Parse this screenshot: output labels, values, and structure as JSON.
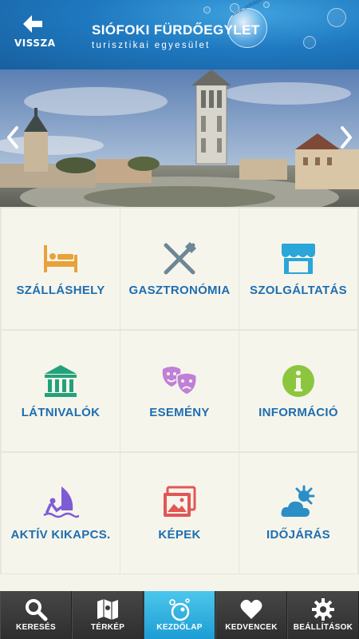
{
  "header": {
    "back_label": "VISSZA",
    "brand_title": "SIÓFOKI FÜRDŐEGYLET",
    "brand_subtitle": "turisztikai egyesület",
    "brand_url": "www.siofokportal.com"
  },
  "banner": {
    "prev_icon": "chevron-left-icon",
    "next_icon": "chevron-right-icon"
  },
  "tiles": [
    {
      "label": "SZÁLLÁSHELY",
      "icon": "bed-icon",
      "color": "#e8a23a"
    },
    {
      "label": "GASZTRONÓMIA",
      "icon": "fork-knife-icon",
      "color": "#6e8796"
    },
    {
      "label": "SZOLGÁLTATÁS",
      "icon": "shop-icon",
      "color": "#2aa6d8"
    },
    {
      "label": "LÁTNIVALÓK",
      "icon": "museum-icon",
      "color": "#22a27b"
    },
    {
      "label": "ESEMÉNY",
      "icon": "theater-masks-icon",
      "color": "#c07fd8"
    },
    {
      "label": "INFORMÁCIÓ",
      "icon": "info-icon",
      "color": "#8cc63f"
    },
    {
      "label": "AKTÍV KIKAPCS.",
      "icon": "windsurf-icon",
      "color": "#7d5cd6"
    },
    {
      "label": "KÉPEK",
      "icon": "pictures-icon",
      "color": "#e25655"
    },
    {
      "label": "IDŐJÁRÁS",
      "icon": "sun-cloud-icon",
      "color": "#2b8fc6"
    }
  ],
  "nav": [
    {
      "label": "KERESÉS",
      "icon": "search-icon"
    },
    {
      "label": "TÉRKÉP",
      "icon": "map-icon"
    },
    {
      "label": "KEZDŐLAP",
      "icon": "home-bubble-icon",
      "active": true
    },
    {
      "label": "KEDVENCEK",
      "icon": "heart-icon"
    },
    {
      "label": "BEÁLLÍTÁSOK",
      "icon": "gear-icon"
    }
  ],
  "colors": {
    "header_blue": "#1f79c0",
    "label_blue": "#1e6eb0",
    "nav_active": "#29aee0",
    "nav_bg": "#3a3a3a"
  }
}
